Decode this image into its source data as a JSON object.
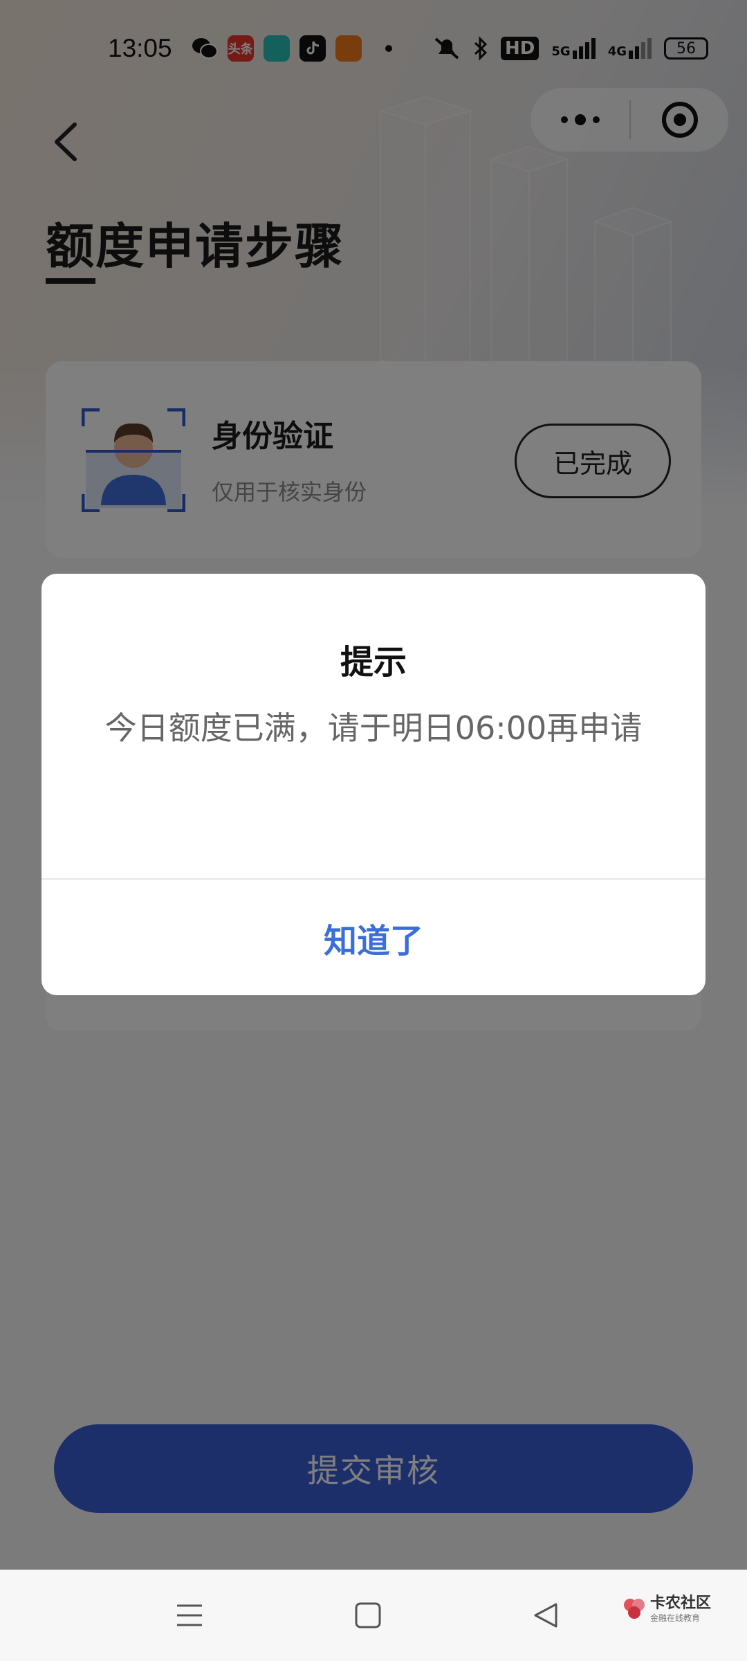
{
  "status_bar": {
    "time": "13:05",
    "notification_icons": [
      "wechat-icon",
      "toutiao-icon",
      "app-icon",
      "tiktok-icon",
      "app-icon",
      "dot-icon"
    ],
    "toutiao_label": "头条",
    "network_hd": "HD",
    "network_5g": "5G",
    "network_4g": "4G",
    "battery": "56"
  },
  "header": {
    "title": "额度申请步骤"
  },
  "steps": [
    {
      "title": "身份验证",
      "subtitle": "仅用于核实身份",
      "status_label": "已完成"
    }
  ],
  "submit": {
    "label": "提交审核"
  },
  "dialog": {
    "title": "提示",
    "message": "今日额度已满，请于明日06:00再申请",
    "confirm_label": "知道了"
  },
  "watermark": {
    "title": "卡农社区",
    "subtitle": "金融在线教育"
  },
  "colors": {
    "accent": "#3b6fd8",
    "submit_bg": "#3a5fd6",
    "overlay": "rgba(0,0,0,0.5)"
  }
}
